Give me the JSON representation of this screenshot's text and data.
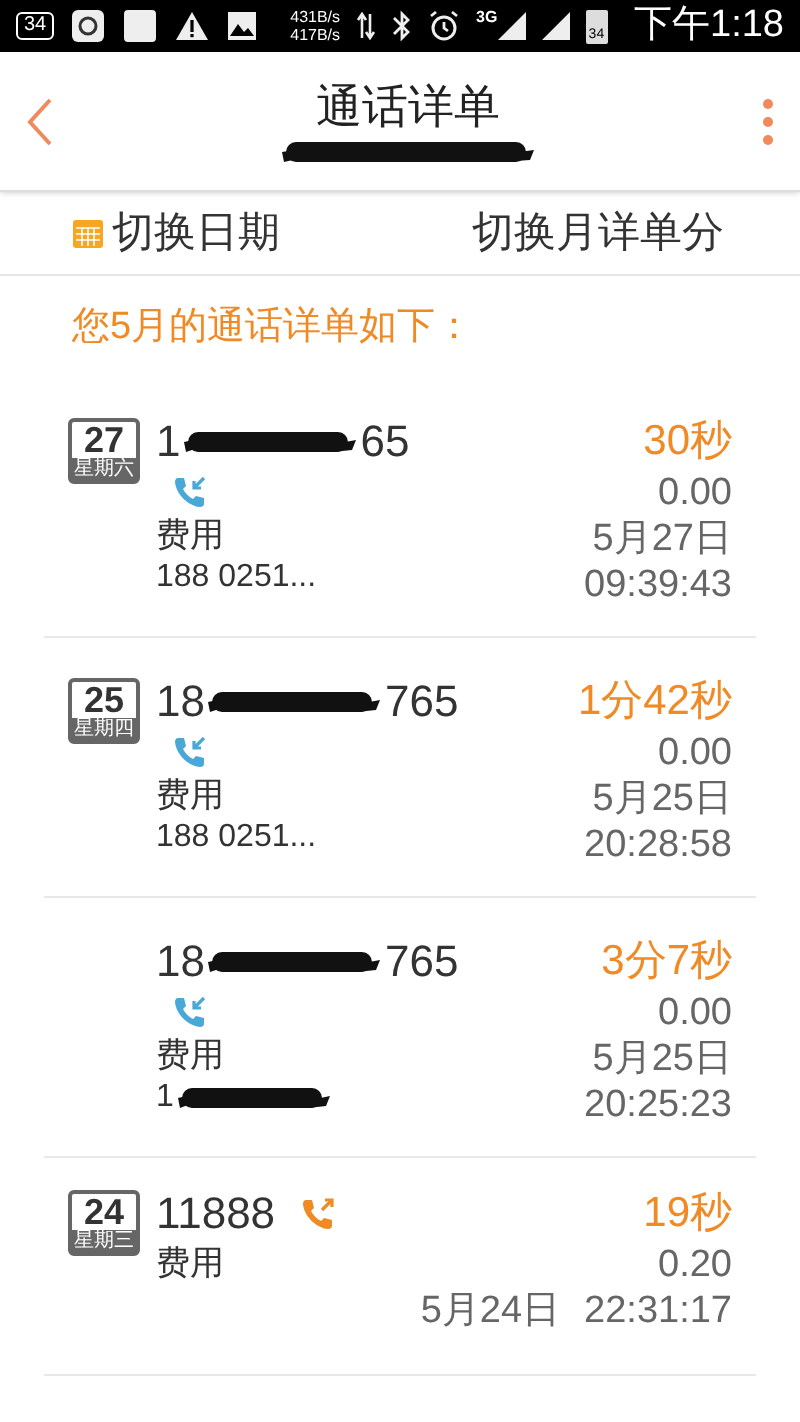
{
  "status_bar": {
    "notification_badge": "34",
    "net_up": "431B/s",
    "net_down": "417B/s",
    "network_type": "3G",
    "battery": "34",
    "time": "下午1:18"
  },
  "header": {
    "title": "通话详单"
  },
  "toolbar": {
    "switch_date": "切换日期",
    "switch_month": "切换月详单分"
  },
  "heading": "您5月的通话详单如下：",
  "records": [
    {
      "kind": "full",
      "day": "27",
      "weekday": "星期六",
      "number_start": "1",
      "number_end": "65",
      "outgoing": false,
      "fee_label": "费用",
      "sub_number": "188 0251...",
      "sub_redacted": false,
      "duration": "30秒",
      "cost": "0.00",
      "date": "5月27日",
      "time": "09:39:43"
    },
    {
      "kind": "full",
      "day": "25",
      "weekday": "星期四",
      "number_start": "18",
      "number_end": "765",
      "outgoing": false,
      "fee_label": "费用",
      "sub_number": "188 0251...",
      "sub_redacted": false,
      "duration": "1分42秒",
      "cost": "0.00",
      "date": "5月25日",
      "time": "20:28:58"
    },
    {
      "kind": "full",
      "number_start": "18",
      "number_end": "765",
      "outgoing": false,
      "fee_label": "费用",
      "sub_number": "1",
      "sub_redacted": true,
      "duration": "3分7秒",
      "cost": "0.00",
      "date": "5月25日",
      "time": "20:25:23"
    },
    {
      "kind": "compact",
      "day": "24",
      "weekday": "星期三",
      "number_start": "11888",
      "outgoing": true,
      "fee_label": "费用",
      "duration": "19秒",
      "cost": "0.20",
      "date": "5月24日",
      "time": "22:31:17"
    }
  ]
}
